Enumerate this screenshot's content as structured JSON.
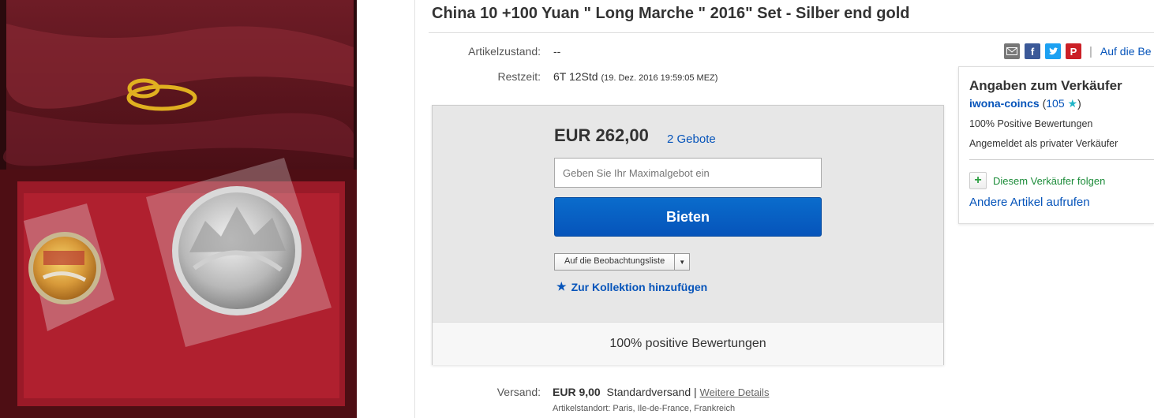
{
  "listing": {
    "title": "China 10 +100 Yuan \" Long Marche \" 2016\" Set - Silber end gold",
    "condition_label": "Artikelzustand:",
    "condition_value": "--",
    "time_label": "Restzeit:",
    "time_value": "6T 12Std",
    "time_detail": "(19. Dez. 2016   19:59:05 MEZ)"
  },
  "share": {
    "mail_icon": "mail-icon",
    "facebook_icon": "facebook-icon",
    "twitter_icon": "twitter-icon",
    "pinterest_icon": "pinterest-icon",
    "separator": "|",
    "watch_link": "Auf die Be"
  },
  "bid": {
    "price": "EUR 262,00",
    "bids_link": "2 Gebote",
    "input_placeholder": "Geben Sie Ihr Maximalgebot ein",
    "bid_button": "Bieten",
    "watchlist_label": "Auf die Beobachtungsliste",
    "collection_label": "Zur Kollektion hinzufügen",
    "feedback_footer": "100% positive Bewertungen"
  },
  "seller": {
    "heading": "Angaben zum Verkäufer",
    "username": "iwona-coincs",
    "score": "105",
    "positive": "100% Positive Bewertungen",
    "account_type": "Angemeldet als privater Verkäufer",
    "follow": "Diesem Verkäufer folgen",
    "other_items": "Andere Artikel aufrufen"
  },
  "shipping": {
    "label": "Versand:",
    "price": "EUR 9,00",
    "method": "Standardversand",
    "separator": "|",
    "details_link": "Weitere Details",
    "location": "Artikelstandort:  Paris, Ile-de-France, Frankreich"
  },
  "colors": {
    "link": "#0654ba",
    "button": "#0654ba",
    "box_bg": "#e7e7e7",
    "follow_green": "#1d8c3a"
  }
}
